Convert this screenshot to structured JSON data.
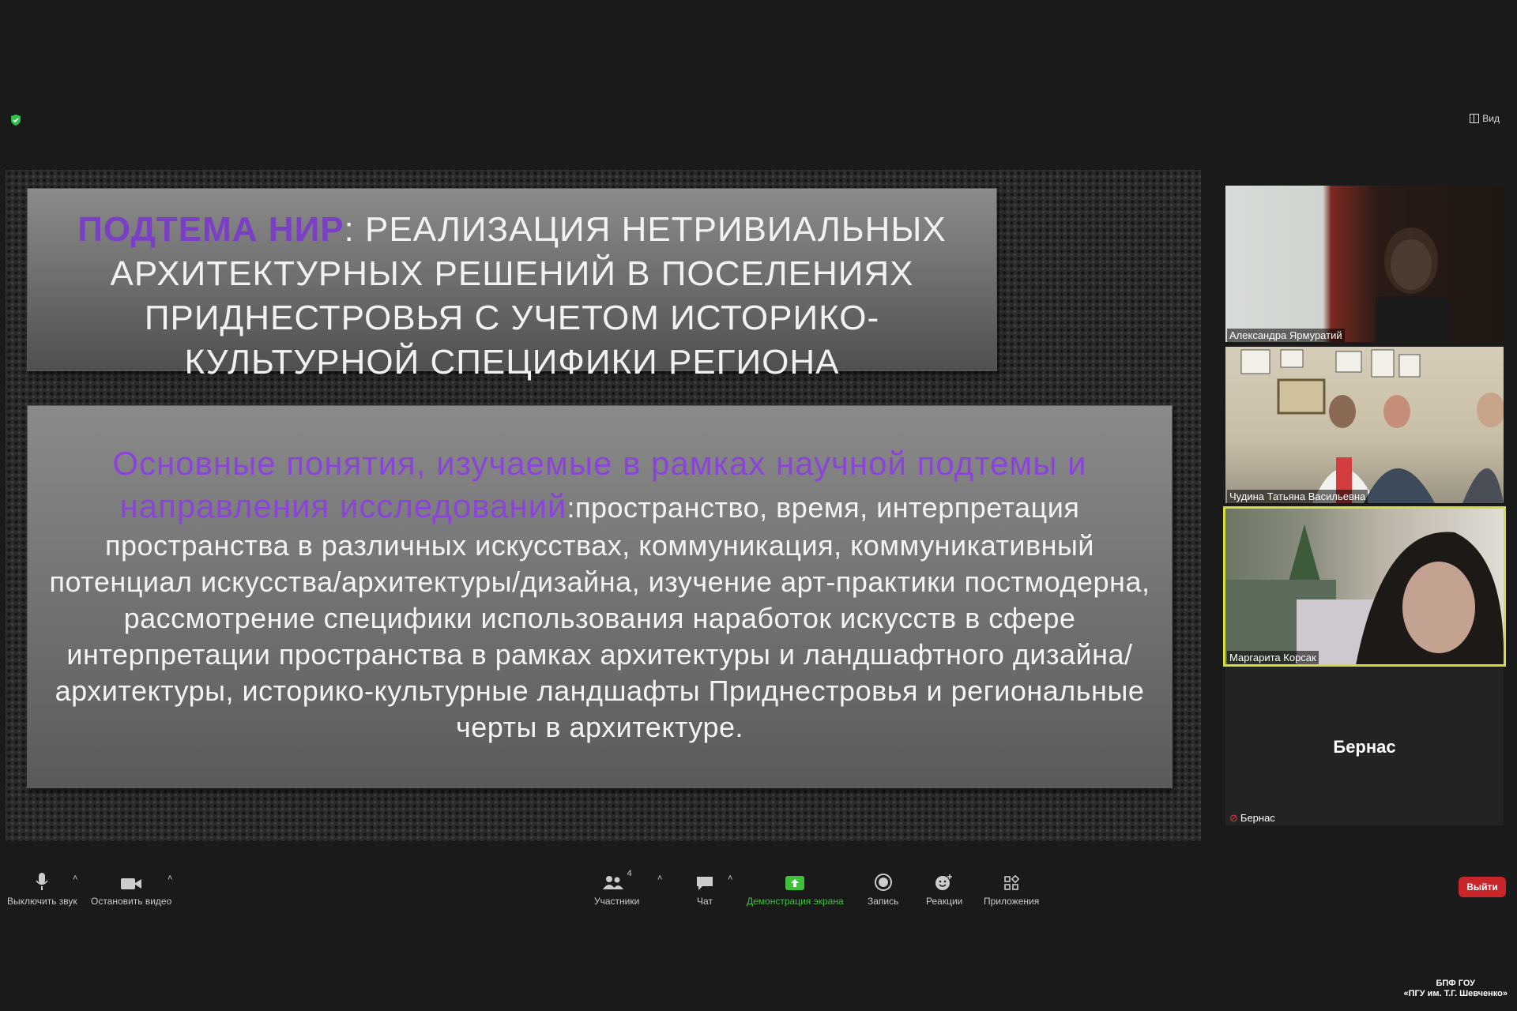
{
  "top": {
    "view_label": "Вид"
  },
  "slide": {
    "title_highlight": "ПОДТЕМА НИР",
    "title_rest": ": РЕАЛИЗАЦИЯ НЕТРИВИАЛЬНЫХ АРХИТЕКТУРНЫХ РЕШЕНИЙ В ПОСЕЛЕНИЯХ ПРИДНЕСТРОВЬЯ С УЧЕТОМ ИСТОРИКО-КУЛЬТУРНОЙ СПЕЦИФИКИ РЕГИОНА",
    "body_highlight": "Основные понятия, изучаемые в рамках научной подтемы и направления исследований",
    "body_text": ":пространство, время, интерпретация пространства в различных искусствах, коммуникация, коммуникативный потенциал искусства/архитектуры/дизайна, изучение арт-практики постмодерна, рассмотрение специфики использования наработок искусств в сфере интерпретации пространства в рамках архитектуры и ландшафтного дизайна/архитектуры, историко-культурные ландшафты Приднестровья и региональные черты в архитектуре."
  },
  "participants": [
    {
      "name": "Александра Ярмуратий"
    },
    {
      "name": "Чудина Татьяна Васильевна"
    },
    {
      "name": "Маргарита Корсак"
    },
    {
      "name": "Бернас",
      "display_name": "Бернас",
      "muted": true
    }
  ],
  "toolbar": {
    "mute_label": "Выключить звук",
    "video_label": "Остановить видео",
    "participants_label": "Участники",
    "participants_count": "4",
    "chat_label": "Чат",
    "share_label": "Демонстрация экрана",
    "record_label": "Запись",
    "reactions_label": "Реакции",
    "apps_label": "Приложения",
    "leave_label": "Выйти"
  },
  "brand": {
    "line1": "БПФ ГОУ",
    "line2": "«ПГУ им. Т.Г. Шевченко»"
  },
  "colors": {
    "share_green": "#3ec23e",
    "leave_red": "#c9262b",
    "active_speaker": "#d6dc3c",
    "slide_accent": "#7a3fc4"
  }
}
